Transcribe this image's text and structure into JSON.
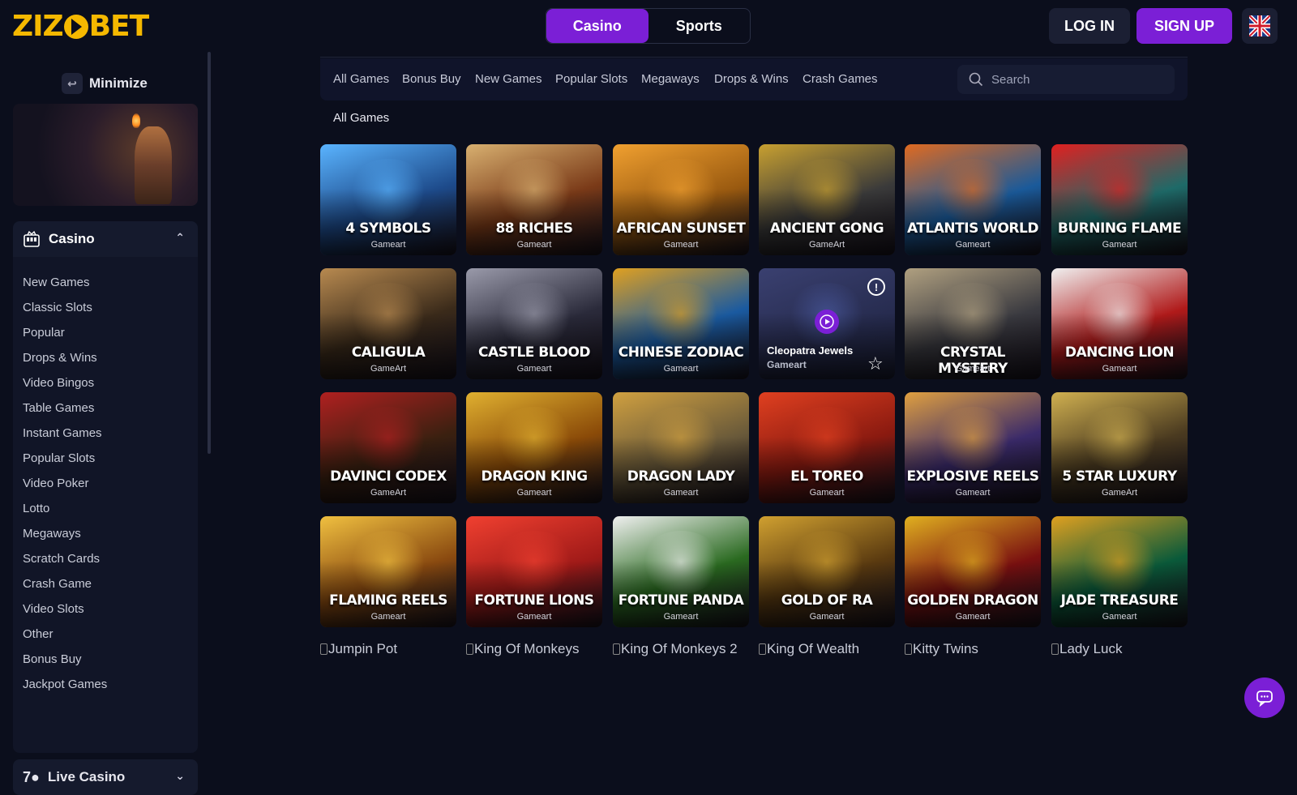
{
  "header": {
    "logo_text": "ZIZOBET",
    "tabs": [
      "Casino",
      "Sports"
    ],
    "active_tab": "Casino",
    "login_label": "LOG IN",
    "signup_label": "SIGN UP",
    "language_icon": "uk-flag-icon"
  },
  "sidebar": {
    "minimize_label": "Minimize",
    "casino_label": "Casino",
    "categories": [
      "New Games",
      "Classic Slots",
      "Popular",
      "Drops & Wins",
      "Video Bingos",
      "Table Games",
      "Instant Games",
      "Popular Slots",
      "Video Poker",
      "Lotto",
      "Megaways",
      "Scratch Cards",
      "Crash Game",
      "Video Slots",
      "Other",
      "Bonus Buy",
      "Jackpot Games"
    ],
    "live_casino_label": "Live Casino"
  },
  "filters": [
    "All Games",
    "Bonus Buy",
    "New Games",
    "Popular Slots",
    "Megaways",
    "Drops & Wins",
    "Crash Games"
  ],
  "search": {
    "placeholder": "Search"
  },
  "section_title": "All Games",
  "games": [
    {
      "name": "4 Symbols",
      "provider": "Gameart",
      "color": "#1d4a8a",
      "accent": "#5ab4ff"
    },
    {
      "name": "88 Riches",
      "provider": "Gameart",
      "color": "#7a3a18",
      "accent": "#d8b070"
    },
    {
      "name": "African Sunset",
      "provider": "Gameart",
      "color": "#9a5a10",
      "accent": "#f0a030"
    },
    {
      "name": "Ancient Gong",
      "provider": "GameArt",
      "color": "#3a3a3a",
      "accent": "#c8a030"
    },
    {
      "name": "Atlantis World",
      "provider": "Gameart",
      "color": "#1a5a9a",
      "accent": "#e06a20"
    },
    {
      "name": "Burning Flame",
      "provider": "Gameart",
      "color": "#1e6a68",
      "accent": "#e02020"
    },
    {
      "name": "Caligula",
      "provider": "GameArt",
      "color": "#3a2a1a",
      "accent": "#b88a50"
    },
    {
      "name": "Castle Blood",
      "provider": "Gameart",
      "color": "#2a2a3a",
      "accent": "#9a9aaa"
    },
    {
      "name": "Chinese Zodiac",
      "provider": "Gameart",
      "color": "#1a5aa0",
      "accent": "#e0a020"
    },
    {
      "name": "Cleopatra Jewels",
      "provider": "Gameart",
      "color": "#2a2f55",
      "accent": "#4a5aa0",
      "hovered": true
    },
    {
      "name": "Crystal Mystery",
      "provider": "Gameart",
      "color": "#3a3a40",
      "accent": "#b0a080"
    },
    {
      "name": "Dancing Lion",
      "provider": "Gameart",
      "color": "#b01a1a",
      "accent": "#f0f0f0"
    },
    {
      "name": "Davinci Codex",
      "provider": "GameArt",
      "color": "#3a2010",
      "accent": "#b02020"
    },
    {
      "name": "Dragon King",
      "provider": "Gameart",
      "color": "#8a4a08",
      "accent": "#e0b030"
    },
    {
      "name": "Dragon Lady",
      "provider": "Gameart",
      "color": "#6a5a3a",
      "accent": "#d0a040"
    },
    {
      "name": "El Toreo",
      "provider": "Gameart",
      "color": "#8a1a10",
      "accent": "#e04020"
    },
    {
      "name": "Explosive Reels",
      "provider": "Gameart",
      "color": "#3a2a6a",
      "accent": "#e0a040"
    },
    {
      "name": "5 Star Luxury",
      "provider": "GameArt",
      "color": "#4a3a20",
      "accent": "#d0b050"
    },
    {
      "name": "Flaming Reels",
      "provider": "Gameart",
      "color": "#8a4a10",
      "accent": "#f0c040"
    },
    {
      "name": "Fortune Lions",
      "provider": "Gameart",
      "color": "#a01a18",
      "accent": "#f04030"
    },
    {
      "name": "Fortune Panda",
      "provider": "Gameart",
      "color": "#2a6a20",
      "accent": "#f0f0f0"
    },
    {
      "name": "Gold Of Ra",
      "provider": "Gameart",
      "color": "#5a3a10",
      "accent": "#d0a030"
    },
    {
      "name": "Golden Dragon",
      "provider": "Gameart",
      "color": "#7a1010",
      "accent": "#e0b020"
    },
    {
      "name": "Jade Treasure",
      "provider": "Gameart",
      "color": "#0a5a3a",
      "accent": "#e0a020"
    }
  ],
  "unloaded_games": [
    "Jumpin Pot",
    "King Of Monkeys",
    "King Of Monkeys 2",
    "King Of Wealth",
    "Kitty Twins",
    "Lady Luck"
  ],
  "chat_icon": "chat-bubble-icon"
}
